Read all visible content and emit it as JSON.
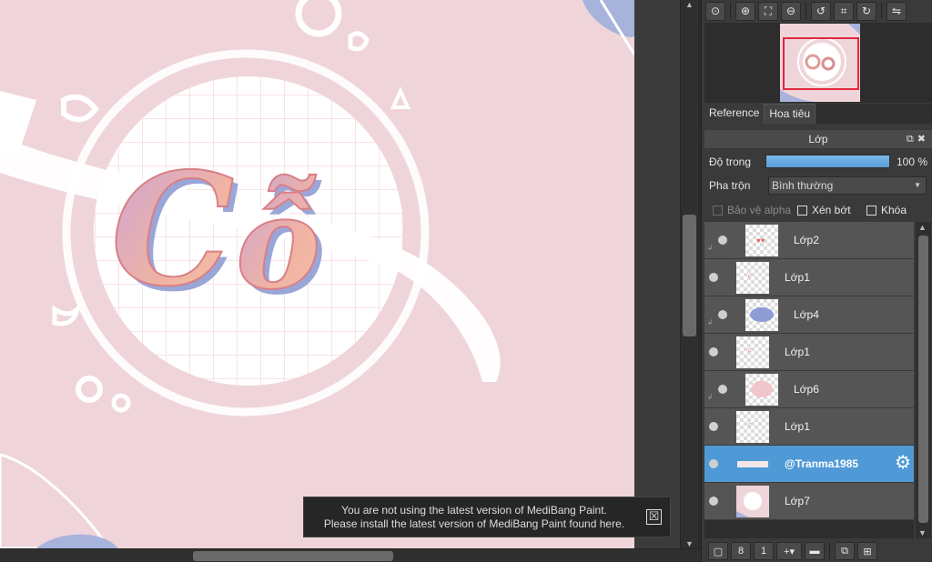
{
  "canvas": {
    "artwork_text": "Cỗ"
  },
  "notification": {
    "line1": "You are not using the latest version of MediBang Paint.",
    "line2": "Please install the latest version of MediBang Paint found here.",
    "close_icon": "☒"
  },
  "toolbar": {
    "buttons": [
      {
        "name": "zoom-actual-icon",
        "glyph": "⊙"
      },
      {
        "name": "zoom-in-icon",
        "glyph": "⊕"
      },
      {
        "name": "fit-view-icon",
        "glyph": "⛶"
      },
      {
        "name": "zoom-out-icon",
        "glyph": "⊖"
      },
      {
        "name": "rotate-left-icon",
        "glyph": "↺"
      },
      {
        "name": "reset-view-icon",
        "glyph": "⌗"
      },
      {
        "name": "rotate-right-icon",
        "glyph": "↻"
      },
      {
        "name": "flip-icon",
        "glyph": "⇋"
      }
    ]
  },
  "tabs": {
    "reference": "Reference",
    "navigator": "Hoa tiêu"
  },
  "layer_panel": {
    "title": "Lớp",
    "opacity_label": "Độ trong",
    "opacity_value": "100 %",
    "opacity_percent": 100,
    "blend_label": "Pha trộn",
    "blend_value": "Bình thường",
    "protect_alpha": "Bảo vệ alpha",
    "clipping": "Xén bớt",
    "lock": "Khóa"
  },
  "layers": [
    {
      "name": "Lớp2",
      "clipped": true,
      "thumb": "hearts"
    },
    {
      "name": "Lớp1",
      "clipped": false,
      "thumb": "small"
    },
    {
      "name": "Lớp4",
      "clipped": true,
      "thumb": "blue-blob"
    },
    {
      "name": "Lớp1",
      "clipped": false,
      "thumb": "small"
    },
    {
      "name": "Lớp6",
      "clipped": true,
      "thumb": "pink-blob"
    },
    {
      "name": "Lớp1",
      "clipped": false,
      "thumb": "small"
    },
    {
      "name": "@Tranma1985",
      "clipped": false,
      "thumb": "text-strip",
      "selected": true
    },
    {
      "name": "Lớp7",
      "clipped": false,
      "thumb": "art"
    }
  ],
  "bottombar": [
    {
      "name": "new-layer-icon",
      "glyph": "▢"
    },
    {
      "name": "new-8bit-layer-icon",
      "glyph": "8"
    },
    {
      "name": "new-1bit-layer-icon",
      "glyph": "1"
    },
    {
      "name": "add-layer-menu-icon",
      "glyph": "+▾"
    },
    {
      "name": "folder-icon",
      "glyph": "▬"
    },
    {
      "name": "duplicate-layer-icon",
      "glyph": "⧉"
    },
    {
      "name": "merge-layer-icon",
      "glyph": "⊞"
    }
  ],
  "colors": {
    "canvas_bg": "#efd5da",
    "selected_layer": "#4f9ad6",
    "navigator_rect": "#e0283c"
  }
}
